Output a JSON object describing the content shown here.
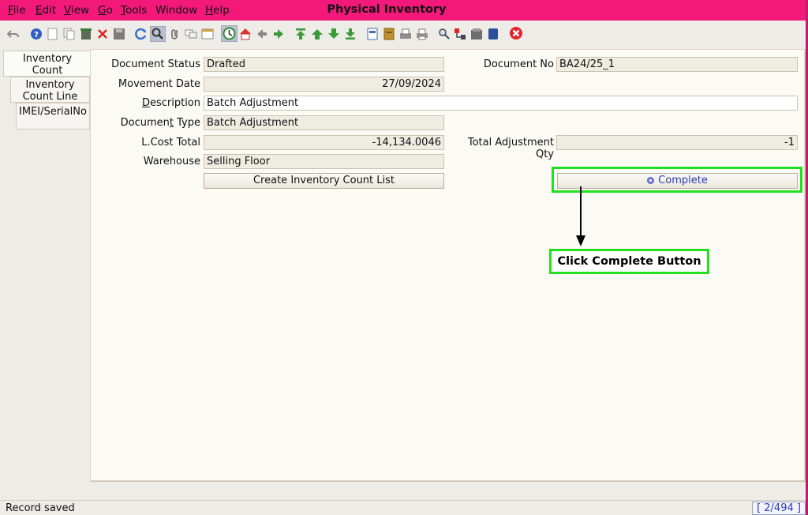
{
  "window": {
    "title": "Physical Inventory"
  },
  "menu": [
    {
      "label": "File",
      "mnemonic": "F",
      "rest": "ile"
    },
    {
      "label": "Edit",
      "mnemonic": "E",
      "rest": "dit"
    },
    {
      "label": "View",
      "mnemonic": "V",
      "rest": "iew"
    },
    {
      "label": "Go",
      "mnemonic": "G",
      "rest": "o"
    },
    {
      "label": "Tools",
      "mnemonic": "T",
      "rest": "ools"
    },
    {
      "label": "Window",
      "mnemonic": "",
      "rest": "Window"
    },
    {
      "label": "Help",
      "mnemonic": "H",
      "rest": "elp"
    }
  ],
  "toolbar": {
    "icons": [
      "undo-icon",
      "help-icon",
      "new-icon",
      "copy-icon",
      "delete-record-icon",
      "delete-icon",
      "save-icon",
      "refresh-icon",
      "find-icon",
      "attachment-icon",
      "chat-icon",
      "grid-toggle-icon",
      "history-icon",
      "home-icon",
      "back-icon",
      "forward-icon",
      "first-record-icon",
      "previous-record-icon",
      "next-record-icon",
      "last-record-icon",
      "report-icon",
      "archive-icon",
      "print-preview-icon",
      "print-icon",
      "zoom-across-icon",
      "workflow-icon",
      "request-icon",
      "product-info-icon",
      "close-window-icon"
    ]
  },
  "tabs": [
    {
      "label_line1": "Inventory",
      "label_line2": "Count",
      "active": true
    },
    {
      "label_line1": "Inventory",
      "label_line2": "Count Line",
      "active": false
    },
    {
      "label_line1": "IMEI/SerialNo",
      "label_line2": "",
      "active": false
    }
  ],
  "form": {
    "document_status": {
      "label": "Document Status",
      "value": "Drafted"
    },
    "document_no": {
      "label": "Document No",
      "value": "BA24/25_1"
    },
    "movement_date": {
      "label": "Movement Date",
      "value": "27/09/2024"
    },
    "description": {
      "label_pre": "",
      "label_mnemonic": "D",
      "label_post": "escription",
      "value": "Batch Adjustment"
    },
    "document_type": {
      "label_pre": "Documen",
      "label_mnemonic": "t",
      "label_post": " Type",
      "value": "Batch Adjustment"
    },
    "lcost_total": {
      "label": "L.Cost Total",
      "value": "-14,134.0046"
    },
    "total_adjustment_qty": {
      "label": "Total Adjustment Qty",
      "value": "-1"
    },
    "warehouse": {
      "label": "Warehouse",
      "value": "Selling Floor"
    },
    "create_count_list_button": "Create Inventory Count List",
    "complete_button": "Complete"
  },
  "annotation": {
    "callout_text": "Click Complete Button",
    "highlight_color": "#22e01f"
  },
  "status": {
    "message": "Record saved",
    "record_counter": "[ 2/494 ]"
  },
  "colors": {
    "title_bar": "#f2197b",
    "accent_blue": "#2a3bb8"
  }
}
